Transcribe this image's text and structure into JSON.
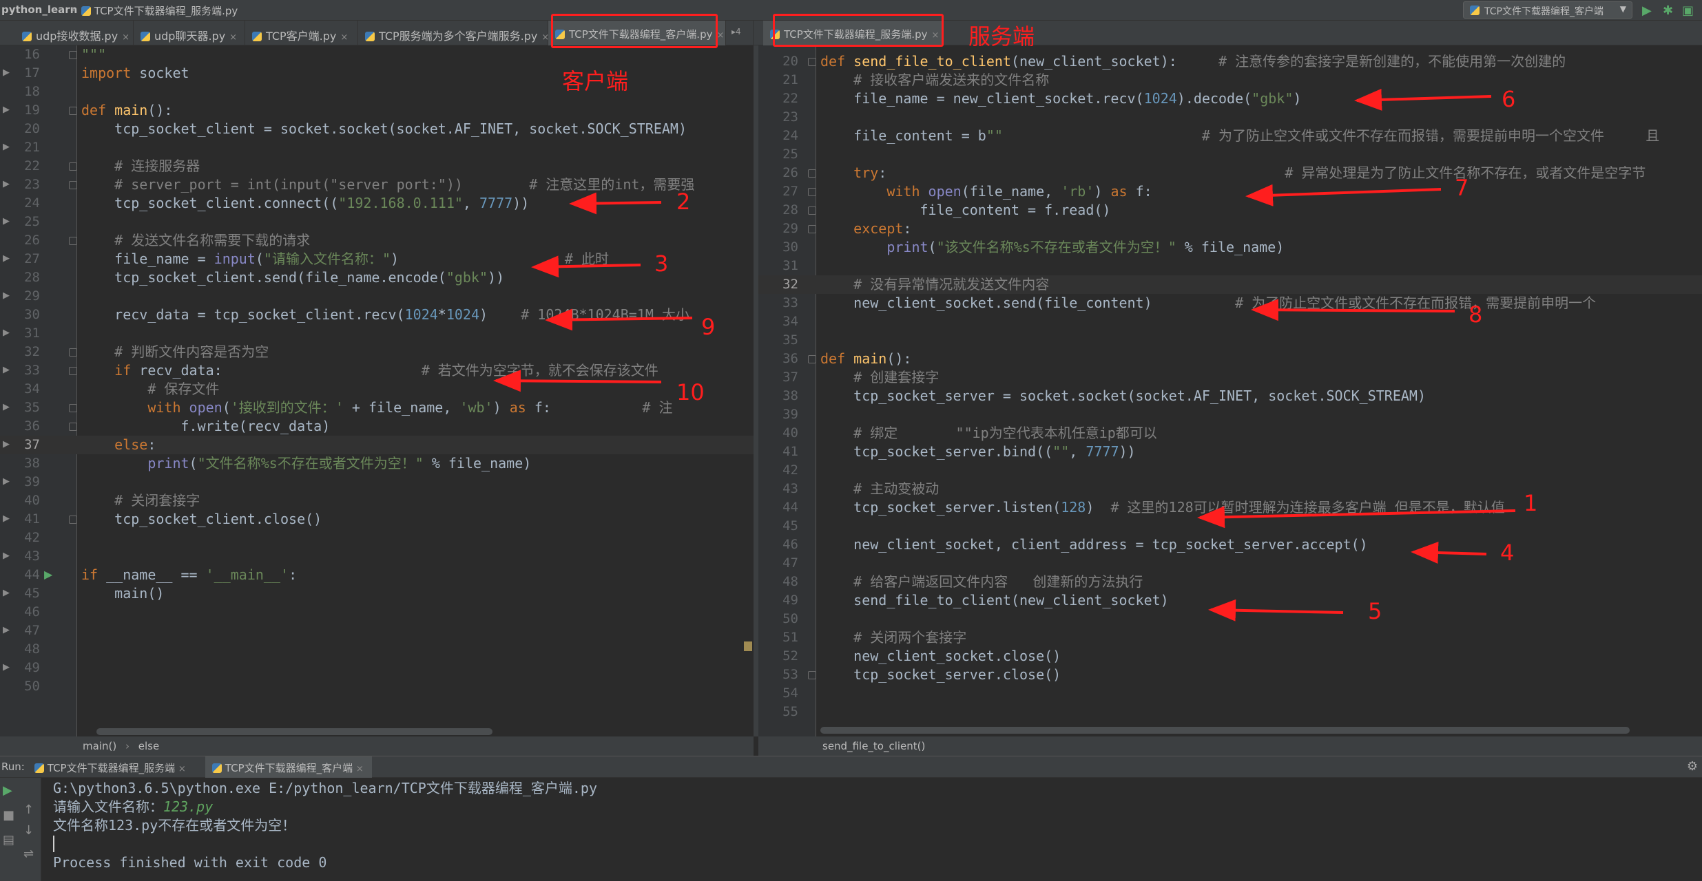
{
  "titlebar": {
    "project": "python_learn",
    "file": "TCP文件下载器编程_服务端.py",
    "run_config": "TCP文件下载器编程_客户端"
  },
  "tabs_left": [
    {
      "label": "udp接收数据.py"
    },
    {
      "label": "udp聊天器.py"
    },
    {
      "label": "TCP客户端.py"
    },
    {
      "label": "TCP服务端为多个客户端服务.py"
    },
    {
      "label": "TCP文件下载器编程_客户端.py"
    }
  ],
  "tabs_right": [
    {
      "label": "TCP文件下载器编程_服务端.py"
    }
  ],
  "tab_overflow": "4",
  "client_code": [
    {
      "n": "16",
      "t": "\"\"\""
    },
    {
      "n": "17",
      "t": "import socket"
    },
    {
      "n": "18",
      "t": ""
    },
    {
      "n": "19",
      "t": "def main():"
    },
    {
      "n": "20",
      "t": "    tcp_socket_client = socket.socket(socket.AF_INET, socket.SOCK_STREAM)"
    },
    {
      "n": "21",
      "t": ""
    },
    {
      "n": "22",
      "t": "    # 连接服务器"
    },
    {
      "n": "23",
      "t": "    # server_port = int(input(\"server port:\"))        # 注意这里的int，需要强"
    },
    {
      "n": "24",
      "t": "    tcp_socket_client.connect((\"192.168.0.111\", 7777))"
    },
    {
      "n": "25",
      "t": ""
    },
    {
      "n": "26",
      "t": "    # 发送文件名称需要下载的请求"
    },
    {
      "n": "27",
      "t": "    file_name = input(\"请输入文件名称：\")                    # 此时"
    },
    {
      "n": "28",
      "t": "    tcp_socket_client.send(file_name.encode(\"gbk\"))"
    },
    {
      "n": "29",
      "t": ""
    },
    {
      "n": "30",
      "t": "    recv_data = tcp_socket_client.recv(1024*1024)    # 1024B*1024B=1M 大小"
    },
    {
      "n": "31",
      "t": ""
    },
    {
      "n": "32",
      "t": "    # 判断文件内容是否为空"
    },
    {
      "n": "33",
      "t": "    if recv_data:                        # 若文件为空字节，就不会保存该文件"
    },
    {
      "n": "34",
      "t": "        # 保存文件"
    },
    {
      "n": "35",
      "t": "        with open('接收到的文件：' + file_name, 'wb') as f:           # 注"
    },
    {
      "n": "36",
      "t": "            f.write(recv_data)"
    },
    {
      "n": "37",
      "t": "    else:"
    },
    {
      "n": "38",
      "t": "        print(\"文件名称%s不存在或者文件为空！\" % file_name)"
    },
    {
      "n": "39",
      "t": ""
    },
    {
      "n": "40",
      "t": "    # 关闭套接字"
    },
    {
      "n": "41",
      "t": "    tcp_socket_client.close()"
    },
    {
      "n": "42",
      "t": ""
    },
    {
      "n": "43",
      "t": ""
    },
    {
      "n": "44",
      "t": "if __name__ == '__main__':"
    },
    {
      "n": "45",
      "t": "    main()"
    },
    {
      "n": "46",
      "t": ""
    },
    {
      "n": "47",
      "t": ""
    },
    {
      "n": "48",
      "t": ""
    },
    {
      "n": "49",
      "t": ""
    },
    {
      "n": "50",
      "t": ""
    }
  ],
  "server_code": [
    {
      "n": "20",
      "t": "def send_file_to_client(new_client_socket):     # 注意传参的套接字是新创建的，不能使用第一次创建的"
    },
    {
      "n": "21",
      "t": "    # 接收客户端发送来的文件名称"
    },
    {
      "n": "22",
      "t": "    file_name = new_client_socket.recv(1024).decode(\"gbk\")"
    },
    {
      "n": "23",
      "t": ""
    },
    {
      "n": "24",
      "t": "    file_content = b\"\"                        # 为了防止空文件或文件不存在而报错，需要提前申明一个空文件     且"
    },
    {
      "n": "25",
      "t": ""
    },
    {
      "n": "26",
      "t": "    try:                                                # 异常处理是为了防止文件名称不存在，或者文件是空字节"
    },
    {
      "n": "27",
      "t": "        with open(file_name, 'rb') as f:"
    },
    {
      "n": "28",
      "t": "            file_content = f.read()"
    },
    {
      "n": "29",
      "t": "    except:"
    },
    {
      "n": "30",
      "t": "        print(\"该文件名称%s不存在或者文件为空！\" % file_name)"
    },
    {
      "n": "31",
      "t": ""
    },
    {
      "n": "32",
      "t": "    # 没有异常情况就发送文件内容"
    },
    {
      "n": "33",
      "t": "    new_client_socket.send(file_content)          # 为了防止空文件或文件不存在而报错，需要提前申明一个"
    },
    {
      "n": "34",
      "t": ""
    },
    {
      "n": "35",
      "t": ""
    },
    {
      "n": "36",
      "t": "def main():"
    },
    {
      "n": "37",
      "t": "    # 创建套接字"
    },
    {
      "n": "38",
      "t": "    tcp_socket_server = socket.socket(socket.AF_INET, socket.SOCK_STREAM)"
    },
    {
      "n": "39",
      "t": ""
    },
    {
      "n": "40",
      "t": "    # 绑定       \"\"ip为空代表本机任意ip都可以"
    },
    {
      "n": "41",
      "t": "    tcp_socket_server.bind((\"\", 7777))"
    },
    {
      "n": "42",
      "t": ""
    },
    {
      "n": "43",
      "t": "    # 主动变被动"
    },
    {
      "n": "44",
      "t": "    tcp_socket_server.listen(128)  # 这里的128可以暂时理解为连接最多客户端 但是不是，默认值"
    },
    {
      "n": "45",
      "t": ""
    },
    {
      "n": "46",
      "t": "    new_client_socket, client_address = tcp_socket_server.accept()"
    },
    {
      "n": "47",
      "t": ""
    },
    {
      "n": "48",
      "t": "    # 给客户端返回文件内容   创建新的方法执行"
    },
    {
      "n": "49",
      "t": "    send_file_to_client(new_client_socket)"
    },
    {
      "n": "50",
      "t": ""
    },
    {
      "n": "51",
      "t": "    # 关闭两个套接字"
    },
    {
      "n": "52",
      "t": "    new_client_socket.close()"
    },
    {
      "n": "53",
      "t": "    tcp_socket_server.close()"
    },
    {
      "n": "54",
      "t": ""
    },
    {
      "n": "55",
      "t": ""
    }
  ],
  "crumbs": {
    "left_1": "main()",
    "left_2": "else",
    "right": "send_file_to_client()"
  },
  "run": {
    "label": "Run:",
    "tab_1": "TCP文件下载器编程_服务端",
    "tab_2": "TCP文件下载器编程_客户端",
    "line_1": "G:\\python3.6.5\\python.exe E:/python_learn/TCP文件下载器编程_客户端.py",
    "line_2_prompt": "请输入文件名称：",
    "line_2_input": "123.py",
    "line_3": "文件名称123.py不存在或者文件为空！",
    "line_4": "Process finished with exit code 0"
  },
  "annotations": {
    "client_label": "客户端",
    "server_label": "服务端",
    "n1": "1",
    "n2": "2",
    "n3": "3",
    "n4": "4",
    "n5": "5",
    "n6": "6",
    "n7": "7",
    "n8": "8",
    "n9": "9",
    "n10": "10"
  },
  "colors": {
    "annotation": "#ff1e1e",
    "keyword": "#cc7832",
    "string": "#6a8759",
    "number": "#6897bb",
    "comment": "#808080",
    "function": "#ffc66d"
  }
}
